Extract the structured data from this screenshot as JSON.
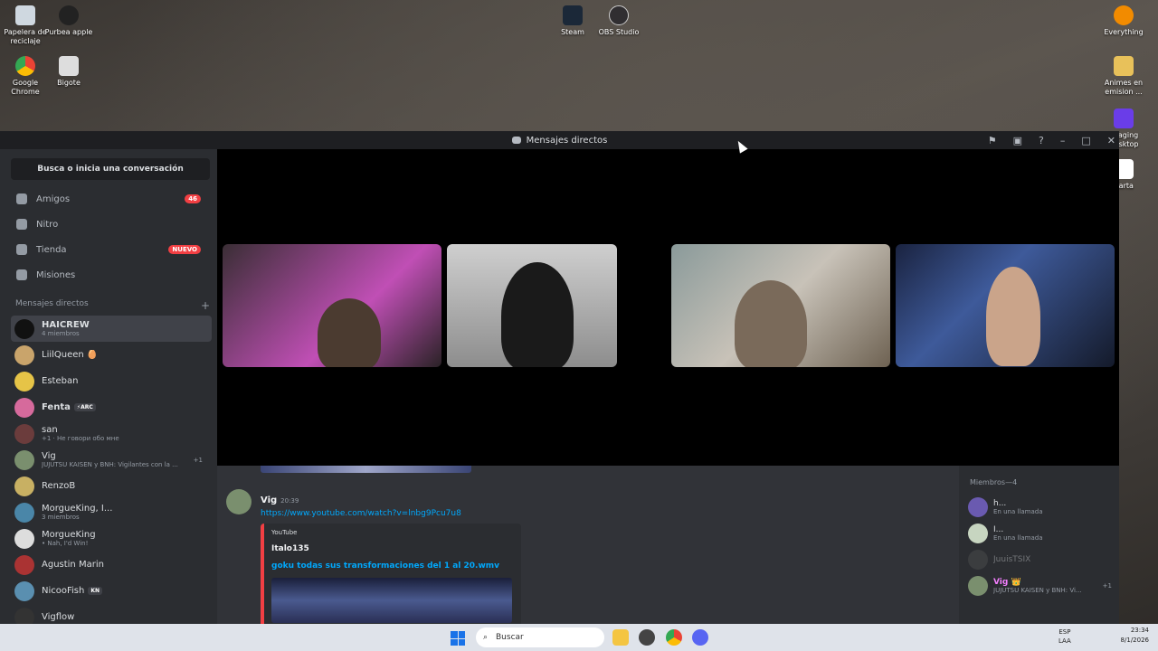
{
  "desktop": {
    "icons": [
      {
        "label": "Papelera de reciclaje"
      },
      {
        "label": "Purbea apple"
      },
      {
        "label": "Google Chrome"
      },
      {
        "label": "Bigote"
      },
      {
        "label": "Steam"
      },
      {
        "label": "OBS Studio"
      },
      {
        "label": "Everything"
      },
      {
        "label": "Animes en emision ..."
      },
      {
        "label": "Imaging Desktop"
      },
      {
        "label": "Carta"
      }
    ]
  },
  "window": {
    "title": "Mensajes directos"
  },
  "sidebar": {
    "search_placeholder": "Busca o inicia una conversación",
    "nav": [
      {
        "label": "Amigos",
        "badge": "46"
      },
      {
        "label": "Nitro",
        "badge": ""
      },
      {
        "label": "Tienda",
        "badge": "NUEVO"
      },
      {
        "label": "Misiones",
        "badge": ""
      }
    ],
    "dm_header": "Mensajes directos",
    "dm_add": "+",
    "dms": [
      {
        "name": "HAICREW",
        "sub": "4 miembros",
        "tag": "",
        "extra": ""
      },
      {
        "name": "LiilQueen 🥚",
        "sub": "",
        "tag": "",
        "extra": ""
      },
      {
        "name": "Esteban",
        "sub": "",
        "tag": "",
        "extra": ""
      },
      {
        "name": "Fenta",
        "sub": "",
        "tag": "⚡ARC",
        "extra": ""
      },
      {
        "name": "san",
        "sub": "+1 · Не говори обо мне",
        "tag": "",
        "extra": ""
      },
      {
        "name": "Vig",
        "sub": "JUJUTSU KAISEN y BNH: Vigilantes con la ...",
        "tag": "",
        "extra": "+1"
      },
      {
        "name": "RenzoB",
        "sub": "",
        "tag": "",
        "extra": ""
      },
      {
        "name": "MorgueKing, I...",
        "sub": "3 miembros",
        "tag": "",
        "extra": ""
      },
      {
        "name": "MorgueKing",
        "sub": "• Nah, I'd Win!",
        "tag": "",
        "extra": ""
      },
      {
        "name": "Agustin Marin",
        "sub": "",
        "tag": "",
        "extra": ""
      },
      {
        "name": "NicooFish",
        "sub": "",
        "tag": "KN",
        "extra": ""
      },
      {
        "name": "Vigflow",
        "sub": "",
        "tag": "",
        "extra": ""
      }
    ]
  },
  "chat": {
    "author": "Vig",
    "time": "20:39",
    "link": "https://www.youtube.com/watch?v=lnbg9Pcu7u8",
    "embed_provider": "YouTube",
    "embed_author": "Italo135",
    "embed_title": "goku todas sus transformaciones del 1 al 20.wmv"
  },
  "members": {
    "header": "Miembros—4",
    "list": [
      {
        "name": "h...",
        "sub": "En una llamada"
      },
      {
        "name": "I...",
        "sub": "En una llamada"
      },
      {
        "name": "JuuisTSIX",
        "sub": ""
      },
      {
        "name": "Vig 👑",
        "sub": "JUJUTSU KAISEN y BNH: Vi...",
        "extra": "+1"
      }
    ]
  },
  "taskbar": {
    "search": "Buscar",
    "lang_top": "ESP",
    "lang_bottom": "LAA",
    "time": "23:34",
    "date": "8/1/2026"
  },
  "colors": {
    "accent_red": "#f23f43",
    "link_blue": "#00a8fc",
    "sidebar_bg": "#2b2d31",
    "main_bg": "#313338"
  }
}
